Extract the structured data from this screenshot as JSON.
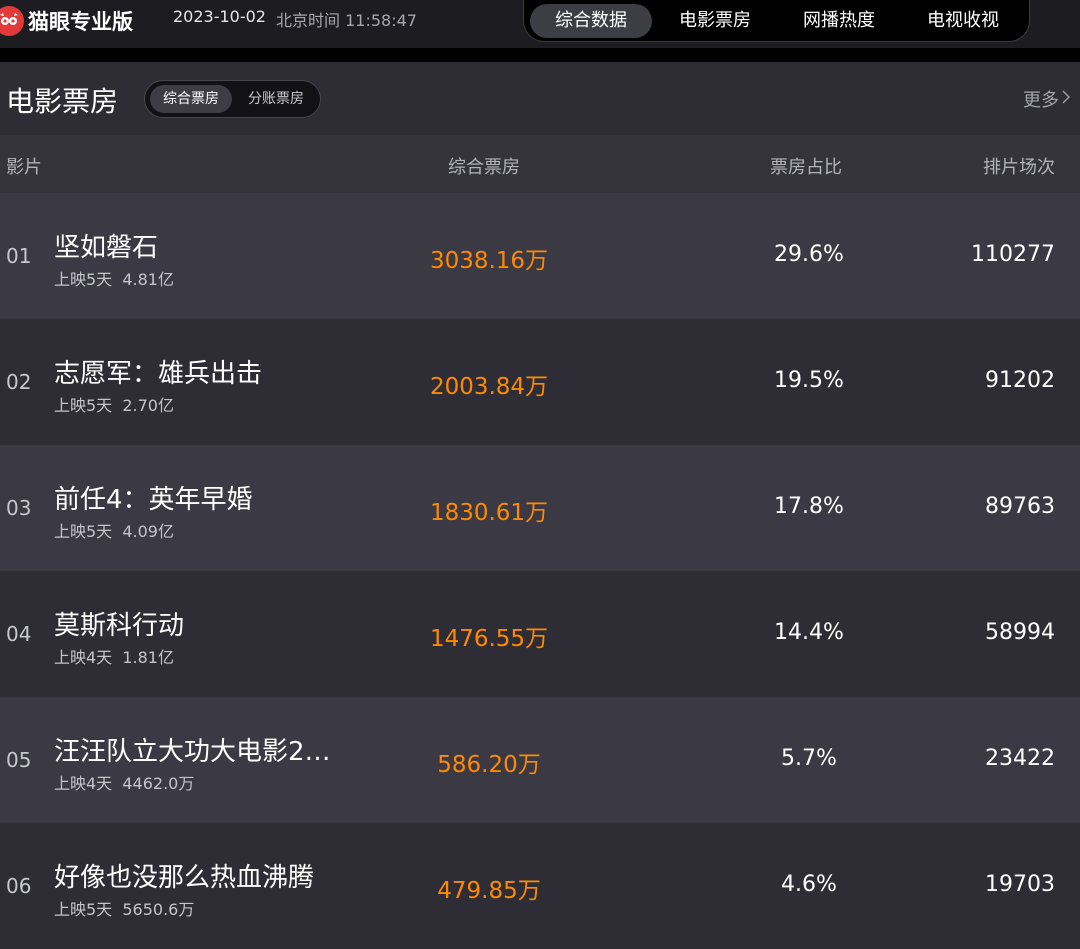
{
  "topbar": {
    "brand": "猫眼专业版",
    "date": "2023-10-02",
    "time": "北京时间 11:58:47",
    "tabs": [
      "综合数据",
      "电影票房",
      "网播热度",
      "电视收视"
    ],
    "active_tab": "综合数据"
  },
  "section": {
    "title": "电影票房",
    "segments": [
      "综合票房",
      "分账票房"
    ],
    "active_segment": "综合票房",
    "more": "更多"
  },
  "table": {
    "headers": [
      "影片",
      "综合票房",
      "票房占比",
      "排片场次"
    ],
    "rows": [
      {
        "rank": "01",
        "title": "坚如磐石",
        "release": "上映5天",
        "total": "4.81亿",
        "box": "3038.16万",
        "pct": "29.6%",
        "shows": "110277"
      },
      {
        "rank": "02",
        "title": "志愿军：雄兵出击",
        "release": "上映5天",
        "total": "2.70亿",
        "box": "2003.84万",
        "pct": "19.5%",
        "shows": "91202"
      },
      {
        "rank": "03",
        "title": "前任4：英年早婚",
        "release": "上映5天",
        "total": "4.09亿",
        "box": "1830.61万",
        "pct": "17.8%",
        "shows": "89763"
      },
      {
        "rank": "04",
        "title": "莫斯科行动",
        "release": "上映4天",
        "total": "1.81亿",
        "box": "1476.55万",
        "pct": "14.4%",
        "shows": "58994"
      },
      {
        "rank": "05",
        "title": "汪汪队立大功大电影2…",
        "release": "上映4天",
        "total": "4462.0万",
        "box": "586.20万",
        "pct": "5.7%",
        "shows": "23422"
      },
      {
        "rank": "06",
        "title": "好像也没那么热血沸腾",
        "release": "上映5天",
        "total": "5650.6万",
        "box": "479.85万",
        "pct": "4.6%",
        "shows": "19703"
      }
    ]
  },
  "colors": {
    "accent": "#ff8a00",
    "logo": "#e23a3a",
    "background": "#2b2a33"
  },
  "icons": [
    "cat-logo-icon",
    "chevron-right-icon"
  ]
}
